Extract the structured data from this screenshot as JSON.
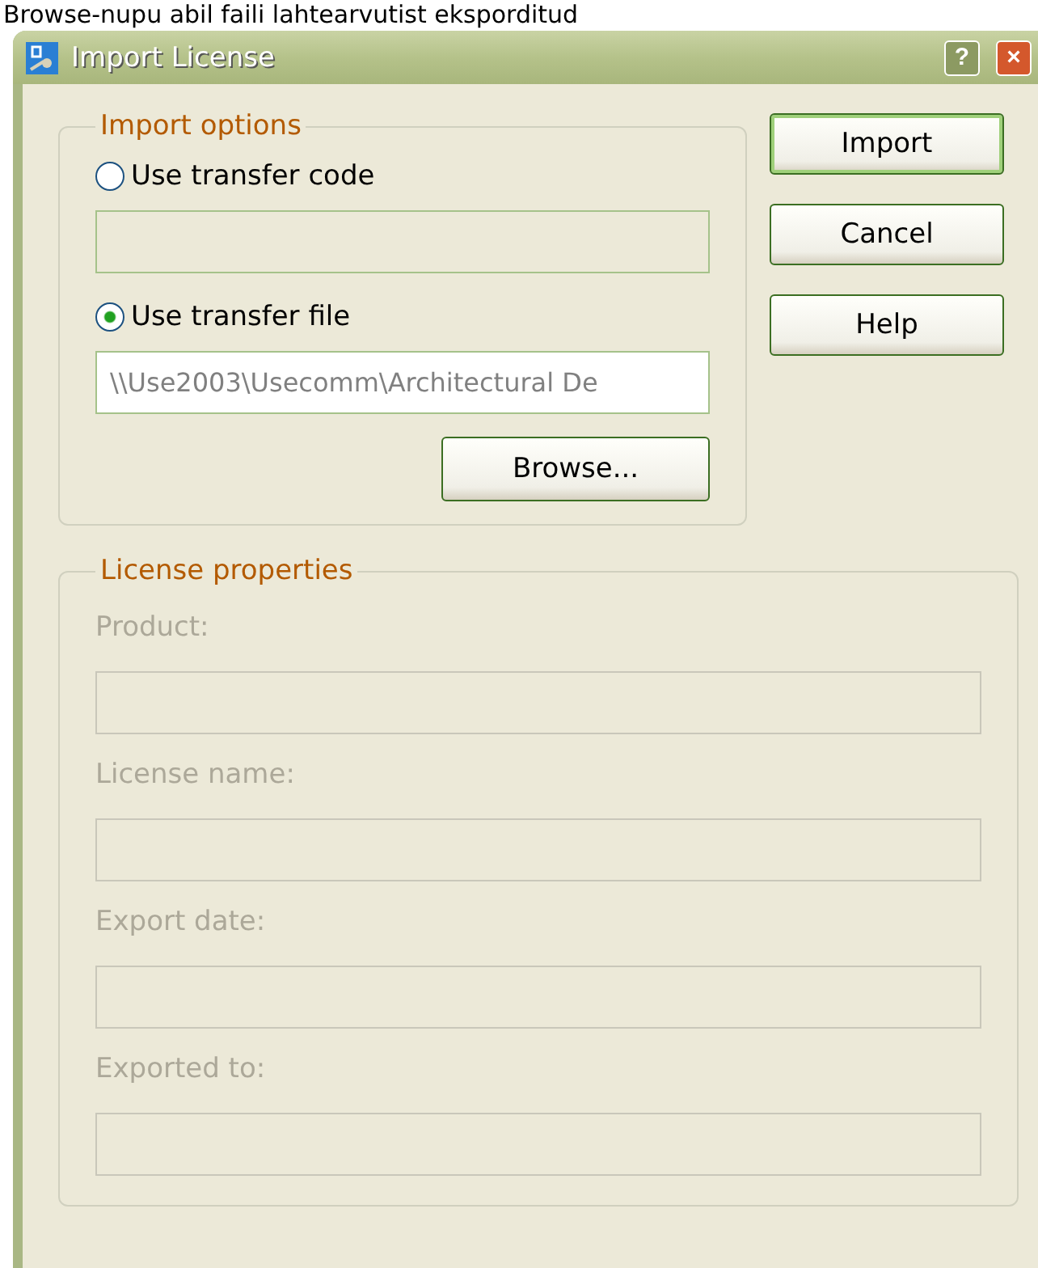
{
  "caption": "Browse-nupu abil faili lahtearvutist eksporditud",
  "window": {
    "title": "Import License",
    "buttons": [
      {
        "kind": "help",
        "label": "?"
      },
      {
        "kind": "close",
        "label": "×"
      }
    ]
  },
  "import_options": {
    "title": "Import options",
    "options": [
      {
        "label": "Use transfer code",
        "selected": false
      },
      {
        "label": "Use transfer file",
        "selected": true,
        "value": "\\\\Use2003\\Usecomm\\Architectural De"
      }
    ],
    "browse_button": "Browse..."
  },
  "actions": [
    {
      "label": "Import",
      "default": true
    },
    {
      "label": "Cancel",
      "default": false
    },
    {
      "label": "Help",
      "default": false
    }
  ],
  "license_properties": {
    "title": "License properties",
    "fields": [
      {
        "label": "Product:",
        "disabled": true
      },
      {
        "label": "License name:",
        "disabled": true
      },
      {
        "label": "Export date:",
        "disabled": true
      },
      {
        "label": "Exported to:",
        "disabled": true
      }
    ]
  }
}
